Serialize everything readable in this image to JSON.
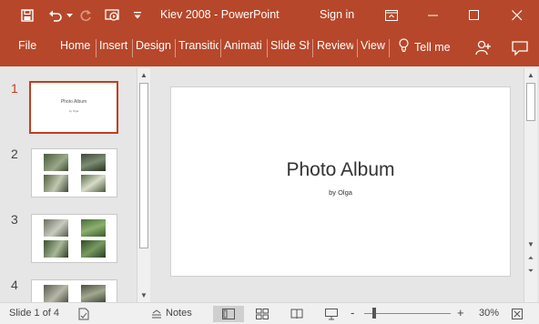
{
  "window": {
    "title": "Kiev 2008  -  PowerPoint",
    "signin": "Sign in",
    "accent": "#b7472a"
  },
  "quick_access": [
    {
      "name": "save-icon"
    },
    {
      "name": "undo-icon"
    },
    {
      "name": "redo-icon"
    },
    {
      "name": "start-from-beginning-icon"
    },
    {
      "name": "customize-qat-icon"
    }
  ],
  "ribbon": {
    "tabs": [
      "File",
      "Home",
      "Insert",
      "Design",
      "Transitic",
      "Animati",
      "Slide Sh",
      "Review",
      "View"
    ],
    "tellme": "Tell me"
  },
  "thumbnails": {
    "numbers": [
      "1",
      "2",
      "3",
      "4"
    ],
    "slide1_title": "Photo Album",
    "slide1_sub": "by Olga"
  },
  "slide": {
    "title": "Photo Album",
    "subtitle": "by Olga"
  },
  "statusbar": {
    "slide_info": "Slide 1 of 4",
    "notes": "Notes",
    "zoom": "30%",
    "zoom_minus": "-",
    "zoom_plus": "+"
  }
}
